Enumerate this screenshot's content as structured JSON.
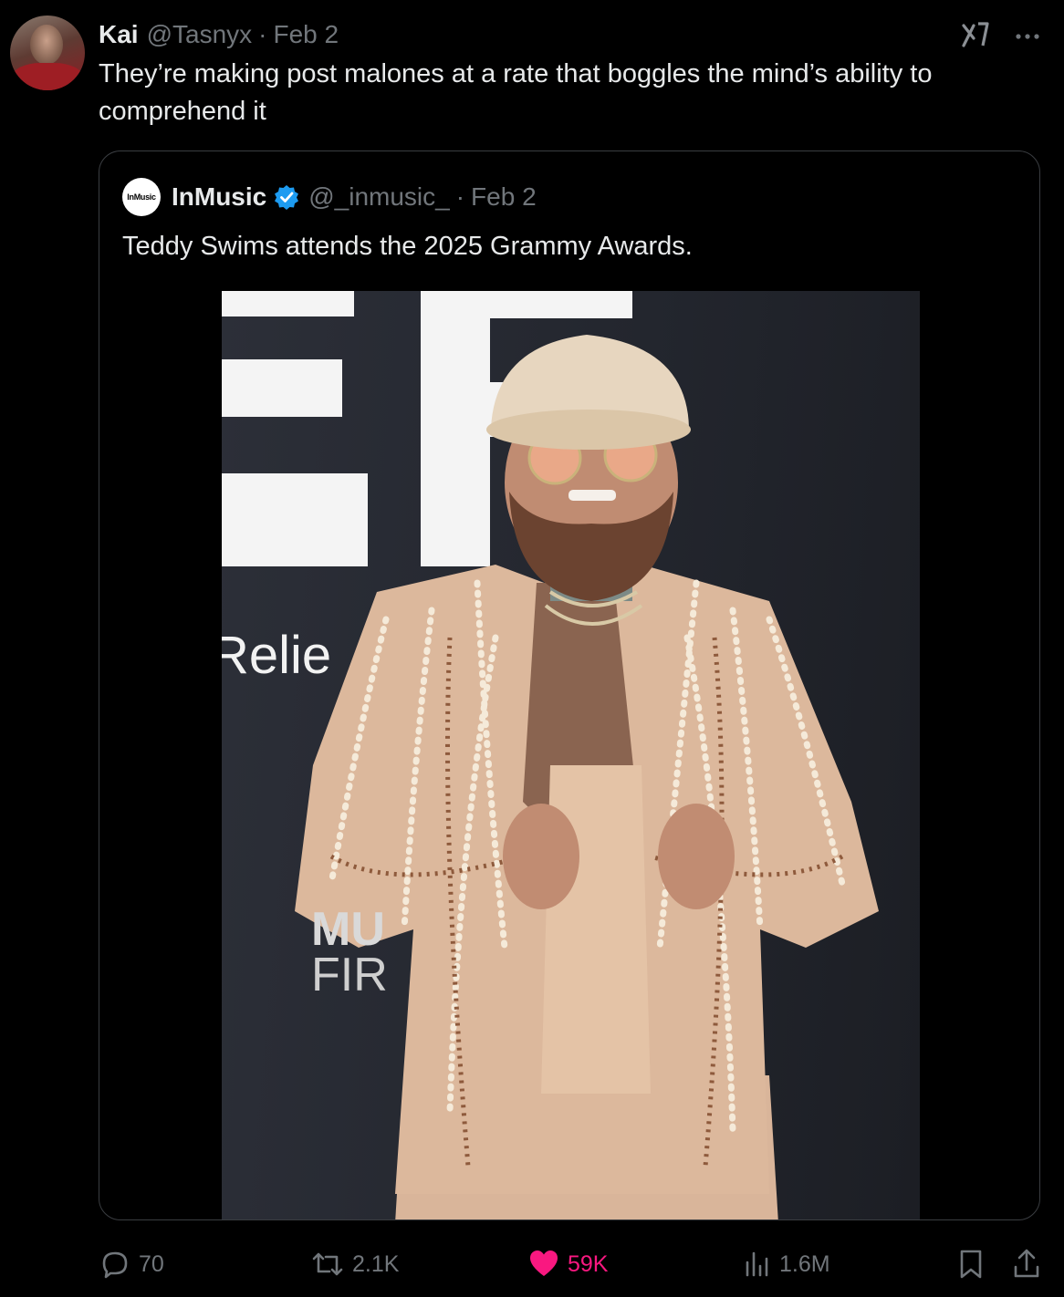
{
  "tweet": {
    "author_name": "Kai",
    "author_handle": "@Tasnyx",
    "separator": "·",
    "date": "Feb 2",
    "text": "They’re making post malones at a rate that boggles the mind’s ability to comprehend it"
  },
  "quoted_tweet": {
    "avatar_text": "InMusic",
    "author_name": "InMusic",
    "author_handle": "@_inmusic_",
    "separator": "·",
    "date": "Feb 2",
    "text": "Teddy Swims attends the 2025 Grammy Awards.",
    "photo_backdrop_text": {
      "top_letters": "EF",
      "middle": "Relie",
      "lower_line1": "MU",
      "lower_line2": "FIR"
    }
  },
  "actions": {
    "replies": "70",
    "reposts": "2.1K",
    "likes": "59K",
    "views": "1.6M"
  },
  "icons": {
    "grok": "grok-icon",
    "more": "more-icon",
    "verified": "verified-badge-icon",
    "reply": "reply-icon",
    "retweet": "retweet-icon",
    "like": "heart-icon",
    "views": "views-icon",
    "bookmark": "bookmark-icon",
    "share": "share-icon"
  },
  "colors": {
    "background": "#000000",
    "text": "#e7e9ea",
    "muted": "#71767b",
    "like": "#f91880",
    "verified": "#1d9bf0",
    "border": "#3a3d41"
  }
}
